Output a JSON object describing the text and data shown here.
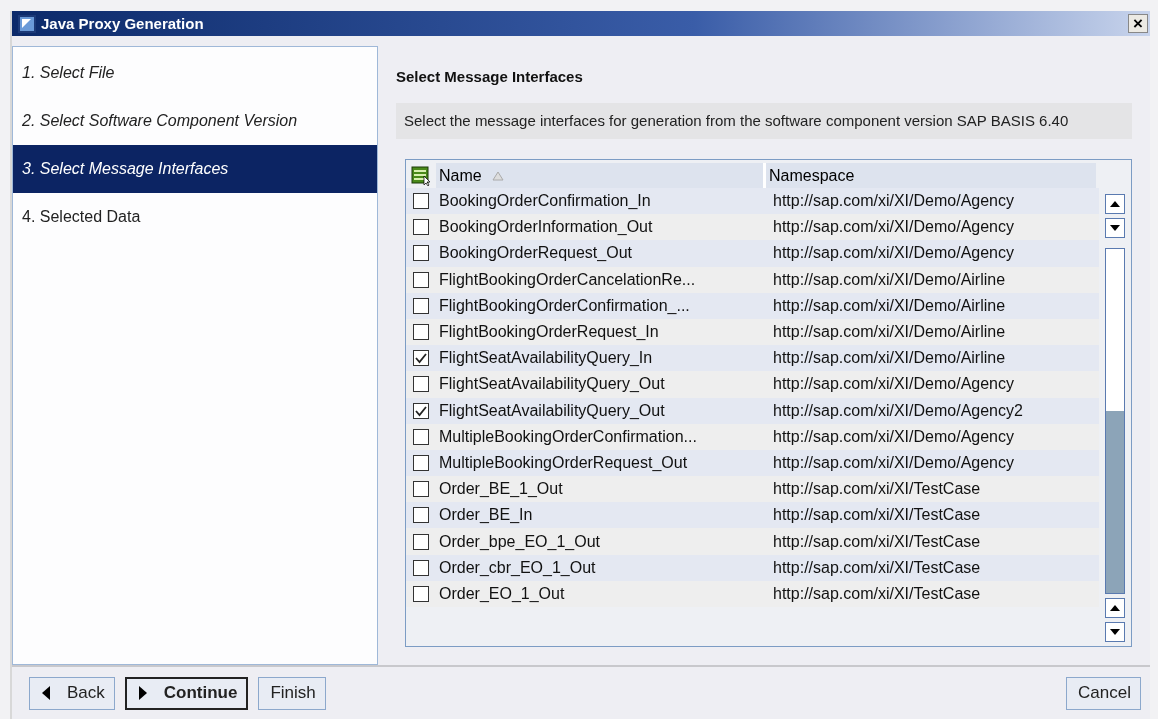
{
  "window": {
    "title": "Java Proxy Generation",
    "close": "×"
  },
  "steps": [
    {
      "label": "1. Select File",
      "visited": true,
      "selected": false
    },
    {
      "label": "2. Select Software Component Version",
      "visited": true,
      "selected": false
    },
    {
      "label": "3. Select Message Interfaces",
      "visited": true,
      "selected": true
    },
    {
      "label": "4. Selected Data",
      "visited": false,
      "selected": false
    }
  ],
  "heading": "Select Message Interfaces",
  "description": "Select the message interfaces for generation from the software component version SAP BASIS 6.40",
  "table": {
    "columns": [
      "Name",
      "Namespace"
    ],
    "rows": [
      {
        "name": "BookingOrderConfirmation_In",
        "namespace": "http://sap.com/xi/XI/Demo/Agency",
        "checked": false
      },
      {
        "name": "BookingOrderInformation_Out",
        "namespace": "http://sap.com/xi/XI/Demo/Agency",
        "checked": false
      },
      {
        "name": "BookingOrderRequest_Out",
        "namespace": "http://sap.com/xi/XI/Demo/Agency",
        "checked": false
      },
      {
        "name": "FlightBookingOrderCancelationRe...",
        "namespace": "http://sap.com/xi/XI/Demo/Airline",
        "checked": false
      },
      {
        "name": "FlightBookingOrderConfirmation_...",
        "namespace": "http://sap.com/xi/XI/Demo/Airline",
        "checked": false
      },
      {
        "name": "FlightBookingOrderRequest_In",
        "namespace": "http://sap.com/xi/XI/Demo/Airline",
        "checked": false
      },
      {
        "name": "FlightSeatAvailabilityQuery_In",
        "namespace": "http://sap.com/xi/XI/Demo/Airline",
        "checked": true
      },
      {
        "name": "FlightSeatAvailabilityQuery_Out",
        "namespace": "http://sap.com/xi/XI/Demo/Agency",
        "checked": false
      },
      {
        "name": "FlightSeatAvailabilityQuery_Out",
        "namespace": "http://sap.com/xi/XI/Demo/Agency2",
        "checked": true
      },
      {
        "name": "MultipleBookingOrderConfirmation...",
        "namespace": "http://sap.com/xi/XI/Demo/Agency",
        "checked": false
      },
      {
        "name": "MultipleBookingOrderRequest_Out",
        "namespace": "http://sap.com/xi/XI/Demo/Agency",
        "checked": false
      },
      {
        "name": "Order_BE_1_Out",
        "namespace": "http://sap.com/xi/XI/TestCase",
        "checked": false
      },
      {
        "name": "Order_BE_In",
        "namespace": "http://sap.com/xi/XI/TestCase",
        "checked": false
      },
      {
        "name": "Order_bpe_EO_1_Out",
        "namespace": "http://sap.com/xi/XI/TestCase",
        "checked": false
      },
      {
        "name": "Order_cbr_EO_1_Out",
        "namespace": "http://sap.com/xi/XI/TestCase",
        "checked": false
      },
      {
        "name": "Order_EO_1_Out",
        "namespace": "http://sap.com/xi/XI/TestCase",
        "checked": false
      }
    ]
  },
  "buttons": [
    {
      "label": "Back",
      "kind": "back",
      "default": false
    },
    {
      "label": "Continue",
      "kind": "next",
      "default": true
    },
    {
      "label": "Finish",
      "kind": "plain",
      "default": false
    }
  ],
  "cancel": "Cancel"
}
